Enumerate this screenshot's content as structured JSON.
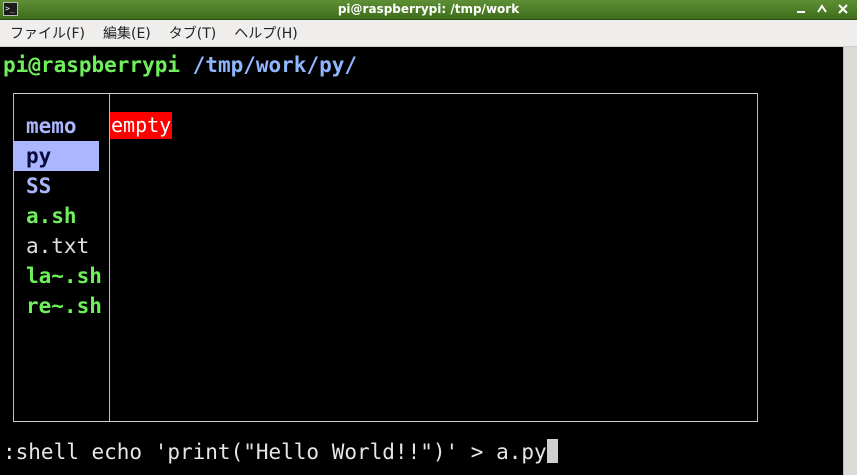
{
  "window": {
    "title": "pi@raspberrypi: /tmp/work",
    "icon": "terminal-icon",
    "controls": [
      "minimize-icon",
      "maximize-icon",
      "close-icon"
    ]
  },
  "menu": {
    "items": [
      "ファイル(F)",
      "編集(E)",
      "タブ(T)",
      "ヘルプ(H)"
    ]
  },
  "terminal": {
    "prompt_user": "pi@raspberrypi",
    "prompt_path": " /tmp/work/py/",
    "files": [
      {
        "name": "memo",
        "type": "dir"
      },
      {
        "name": "py",
        "type": "dir",
        "selected": true
      },
      {
        "name": "SS",
        "type": "dir"
      },
      {
        "name": "a.sh",
        "type": "exec"
      },
      {
        "name": "a.txt",
        "type": "plain"
      },
      {
        "name": "la~.sh",
        "type": "exec"
      },
      {
        "name": "re~.sh",
        "type": "exec"
      }
    ],
    "preview_text": "empty",
    "command_line": ":shell echo 'print(\"Hello World!!\")' > a.py"
  },
  "colors": {
    "titlebar": "#4f7f28",
    "directory": "#aab7ff",
    "executable": "#6ef05a",
    "preview_bg": "#ff0000"
  }
}
